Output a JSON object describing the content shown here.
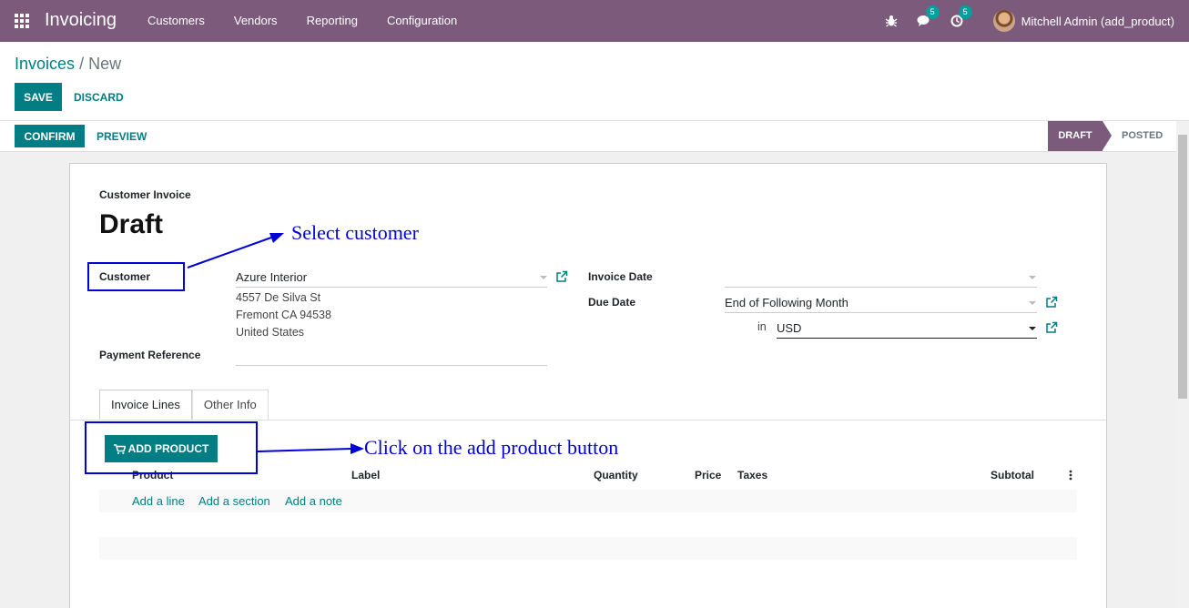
{
  "navbar": {
    "brand": "Invoicing",
    "menu": [
      {
        "label": "Customers"
      },
      {
        "label": "Vendors"
      },
      {
        "label": "Reporting"
      },
      {
        "label": "Configuration"
      }
    ],
    "messages_count": "5",
    "activities_count": "5",
    "user_name": "Mitchell Admin (add_product)"
  },
  "breadcrumb": {
    "parent": "Invoices",
    "separator": "/",
    "current": "New"
  },
  "control": {
    "save_label": "SAVE",
    "discard_label": "DISCARD"
  },
  "statusbar": {
    "confirm_label": "CONFIRM",
    "preview_label": "PREVIEW",
    "stages": [
      {
        "label": "DRAFT",
        "active": true
      },
      {
        "label": "POSTED",
        "active": false
      }
    ]
  },
  "form": {
    "doc_type": "Customer Invoice",
    "title": "Draft",
    "customer_label": "Customer",
    "customer_value": "Azure Interior",
    "address_line1": "4557 De Silva St",
    "address_line2": "Fremont CA 94538",
    "address_line3": "United States",
    "payment_ref_label": "Payment Reference",
    "payment_ref_value": "",
    "invoice_date_label": "Invoice Date",
    "invoice_date_value": "",
    "due_date_label": "Due Date",
    "due_date_value": "End of Following Month",
    "currency_prefix": "in",
    "currency_value": "USD"
  },
  "tabs": [
    {
      "label": "Invoice Lines",
      "active": true
    },
    {
      "label": "Other Info",
      "active": false
    }
  ],
  "lines": {
    "add_product_label": "ADD PRODUCT",
    "columns": [
      "Product",
      "Label",
      "Quantity",
      "Price",
      "Taxes",
      "Subtotal"
    ],
    "add_line": "Add a line",
    "add_section": "Add a section",
    "add_note": "Add a note"
  },
  "annotations": {
    "select_customer": "Select customer",
    "click_add_product": "Click on the add product button"
  },
  "colors": {
    "navbar": "#7c5a7c",
    "primary": "#017e84",
    "annotation": "#0000d8"
  }
}
